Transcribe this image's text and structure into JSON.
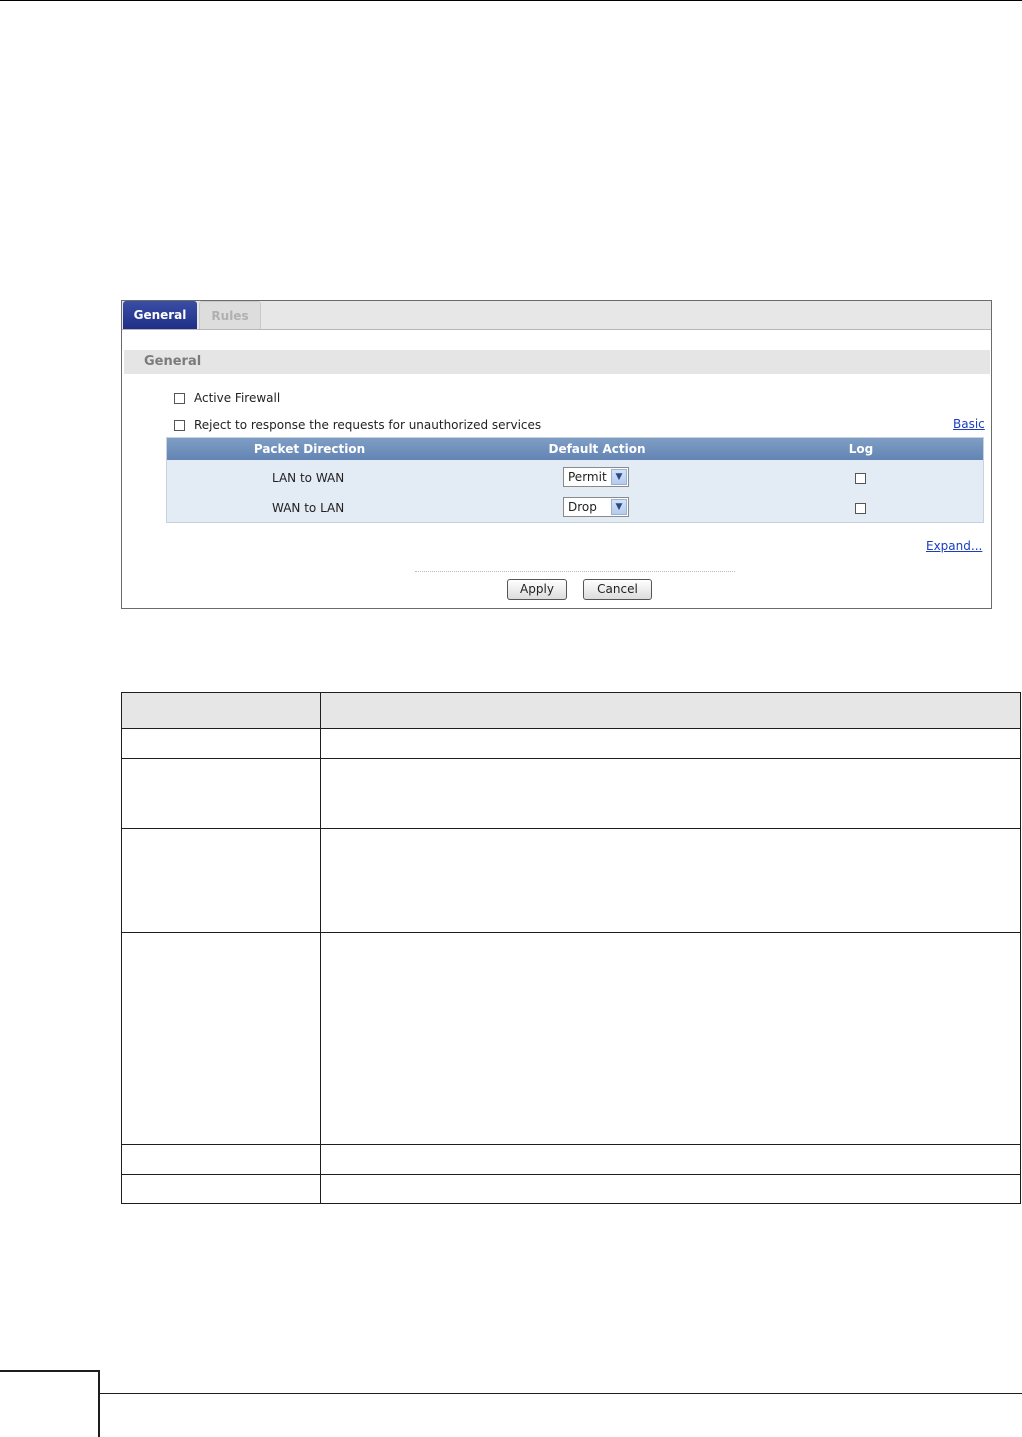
{
  "tabs": [
    {
      "label": "General",
      "active": true
    },
    {
      "label": "Rules",
      "active": false
    }
  ],
  "section_title": "General",
  "options": {
    "active_firewall": {
      "label": "Active Firewall",
      "checked": false
    },
    "reject_unauthorized": {
      "label": "Reject to response the requests for unauthorized services",
      "checked": false
    }
  },
  "links": {
    "basic": "Basic",
    "expand": "Expand..."
  },
  "table": {
    "headers": [
      "Packet Direction",
      "Default Action",
      "Log"
    ],
    "rows": [
      {
        "direction": "LAN to WAN",
        "action": "Permit",
        "log": false
      },
      {
        "direction": "WAN to LAN",
        "action": "Drop",
        "log": false
      }
    ]
  },
  "buttons": {
    "apply": "Apply",
    "cancel": "Cancel"
  },
  "colors": {
    "tab_active": "#2b3c96",
    "grid_header": "#7092c0",
    "grid_body": "#e3ebf4",
    "link": "#1a3dc1"
  }
}
